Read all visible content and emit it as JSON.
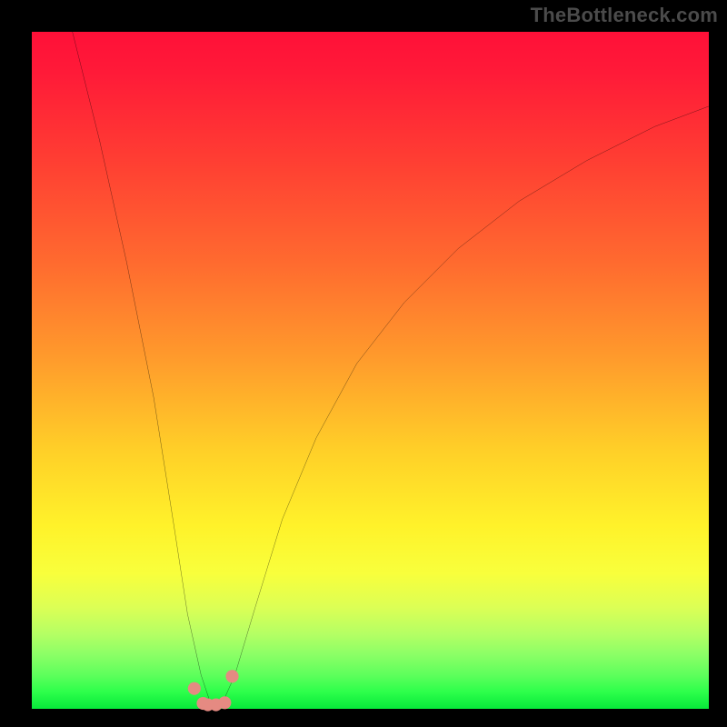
{
  "watermark": "TheBottleneck.com",
  "chart_data": {
    "type": "line",
    "title": "",
    "xlabel": "",
    "ylabel": "",
    "xlim": [
      0,
      100
    ],
    "ylim": [
      0,
      100
    ],
    "curve": {
      "name": "bottleneck-curve",
      "x": [
        6,
        10,
        14,
        18,
        21,
        23,
        25,
        26.5,
        28,
        30,
        33,
        37,
        42,
        48,
        55,
        63,
        72,
        82,
        92,
        100
      ],
      "y": [
        100,
        84,
        66,
        46,
        27,
        14,
        5,
        0.5,
        0.5,
        5,
        15,
        28,
        40,
        51,
        60,
        68,
        75,
        81,
        86,
        89
      ]
    },
    "markers": {
      "name": "valley-dots",
      "color": "#e58a82",
      "x": [
        24.0,
        25.3,
        26.0,
        27.2,
        28.5,
        29.6
      ],
      "y": [
        3.0,
        0.8,
        0.6,
        0.6,
        0.9,
        4.8
      ]
    },
    "colors": {
      "curve_stroke": "#000000",
      "marker_fill": "#e58a82",
      "gradient_top": "#ff1038",
      "gradient_mid": "#fff22a",
      "gradient_bottom": "#07e83a",
      "frame_background": "#000000",
      "watermark_text": "#4b4b4b"
    }
  }
}
